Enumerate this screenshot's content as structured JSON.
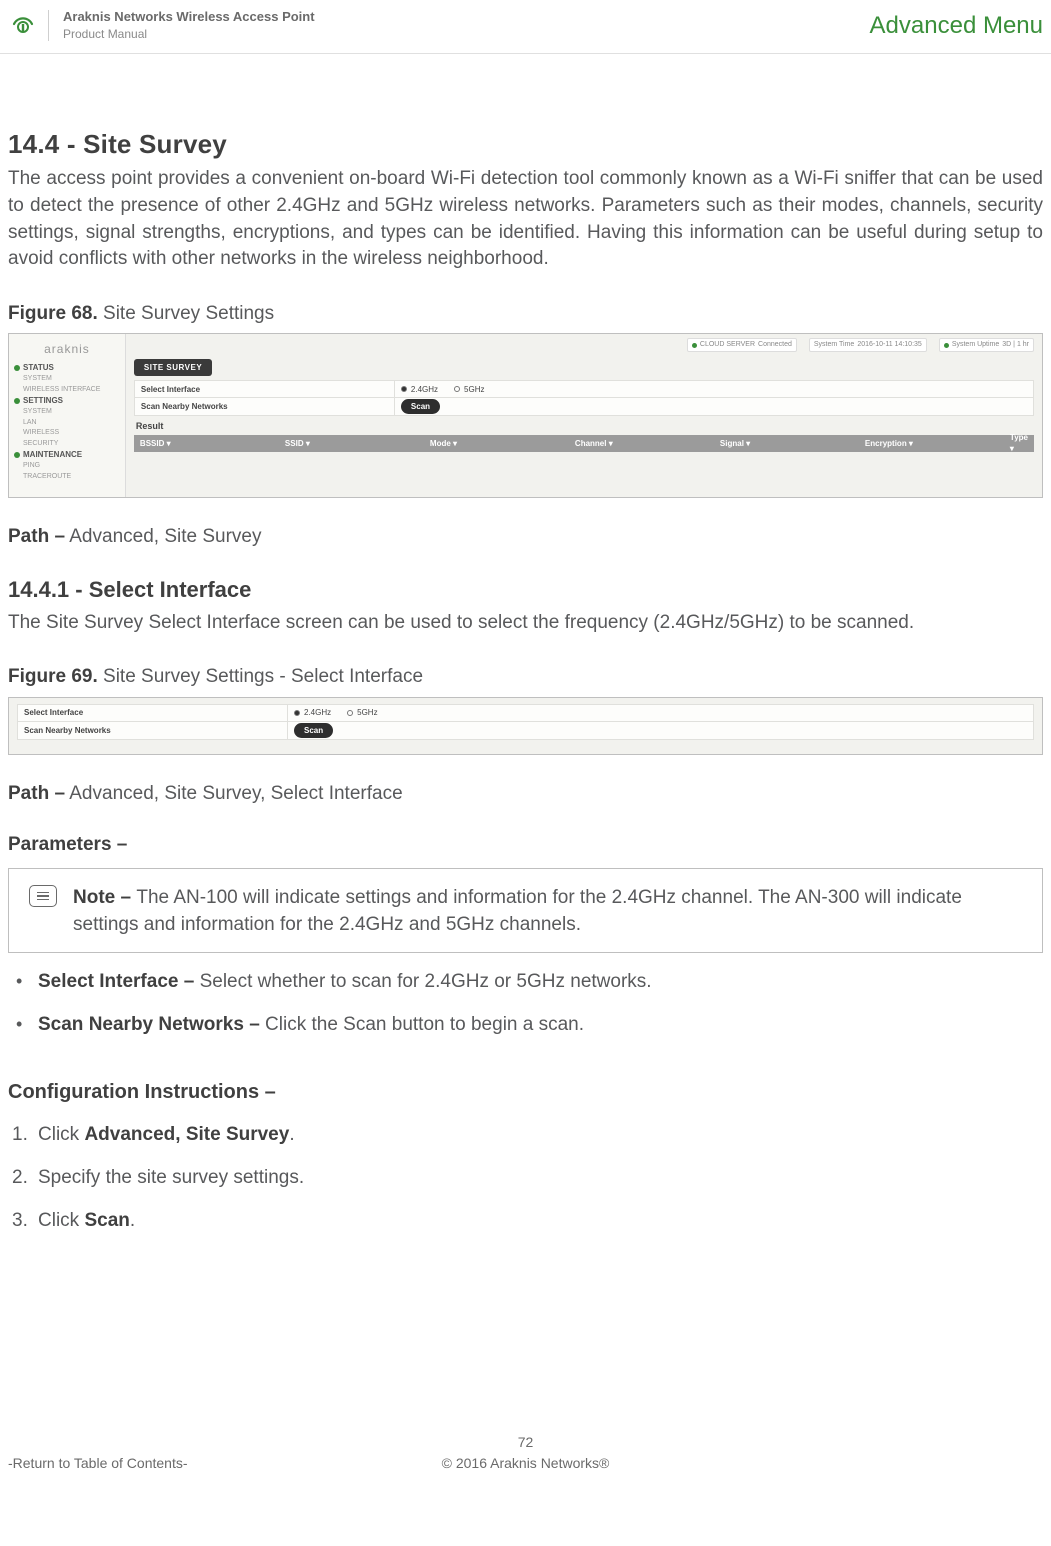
{
  "header": {
    "product_line": "Araknis Networks Wireless Access Point",
    "subtitle": "Product Manual",
    "adv_menu": "Advanced Menu"
  },
  "s1": {
    "heading": "14.4 - Site Survey",
    "body": "The access point provides a convenient on-board Wi-Fi detection tool commonly known as a Wi-Fi sniffer that can be used to detect the presence of other 2.4GHz and 5GHz wireless networks. Parameters such as their modes, channels, security settings, signal strengths, encryptions, and types can be identified. Having this information can be useful during setup to avoid conflicts with other networks in the wireless neighborhood."
  },
  "fig68": {
    "label_bold": "Figure 68.",
    "label_rest": " Site Survey Settings"
  },
  "shot": {
    "brand": "araknis",
    "nav": {
      "status": "STATUS",
      "status_items": [
        "SYSTEM",
        "WIRELESS INTERFACE"
      ],
      "settings": "SETTINGS",
      "settings_items": [
        "SYSTEM",
        "LAN",
        "WIRELESS",
        "SECURITY"
      ],
      "maint": "MAINTENANCE",
      "maint_items": [
        "PING",
        "TRACEROUTE"
      ]
    },
    "top": {
      "cloud": "CLOUD SERVER",
      "cloud_val": "Connected",
      "time": "System Time",
      "time_val": "2016-10-11 14:10:35",
      "uptime": "System Uptime",
      "uptime_val": "3D | 1 hr"
    },
    "tab": "SITE SURVEY",
    "row_if": "Select Interface",
    "opt_24": "2.4GHz",
    "opt_5": "5GHz",
    "row_scan": "Scan Nearby Networks",
    "scan_btn": "Scan",
    "result": "Result",
    "cols": [
      "BSSID ▾",
      "SSID ▾",
      "Mode ▾",
      "Channel ▾",
      "Signal ▾",
      "Encryption ▾",
      "Type ▾"
    ]
  },
  "path1": {
    "label": "Path –",
    "value": " Advanced, Site Survey"
  },
  "s2": {
    "heading": "14.4.1 - Select Interface",
    "body": "The Site Survey Select Interface screen can be used to select the frequency (2.4GHz/5GHz) to be scanned."
  },
  "fig69": {
    "label_bold": "Figure 69.",
    "label_rest": " Site Survey Settings - Select Interface"
  },
  "path2": {
    "label": "Path –",
    "value": " Advanced, Site Survey, Select Interface"
  },
  "params_title": "Parameters –",
  "note": {
    "label": "Note – ",
    "text": "The AN-100 will indicate settings and information for the 2.4GHz channel. The AN-300 will indicate settings and information for the 2.4GHz and 5GHz channels."
  },
  "params": [
    {
      "name": "Select Interface – ",
      "desc": "Select whether to scan for 2.4GHz or 5GHz networks."
    },
    {
      "name": "Scan Nearby Networks – ",
      "desc": "Click the Scan button to begin a scan."
    }
  ],
  "config_title": "Configuration Instructions –",
  "steps": [
    {
      "pre": "Click ",
      "bold": "Advanced, Site Survey",
      "post": "."
    },
    {
      "pre": "Specify the site survey settings.",
      "bold": "",
      "post": ""
    },
    {
      "pre": "Click ",
      "bold": "Scan",
      "post": "."
    }
  ],
  "footer": {
    "toc": "-Return to Table of Contents-",
    "page": "72",
    "copyright": "© 2016 Araknis Networks®"
  }
}
